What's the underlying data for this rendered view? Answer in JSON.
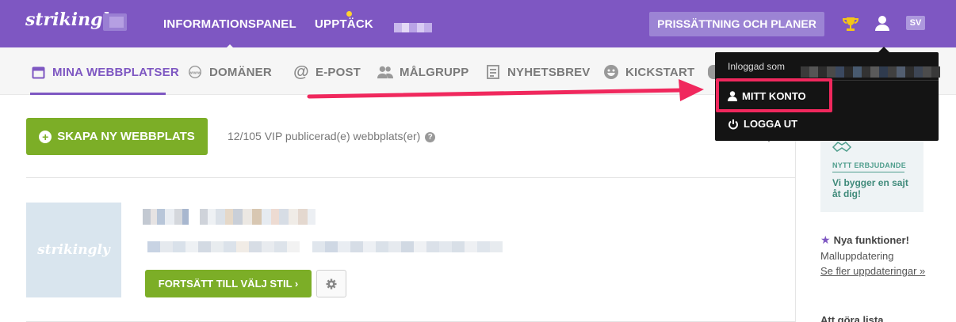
{
  "topbar": {
    "logo": "strikingly",
    "nav": [
      "INFORMATIONSPANEL",
      "UPPTÄCK"
    ],
    "pricing_button": "PRISSÄTTNING OCH PLANER",
    "language": "SV"
  },
  "subnav": {
    "items": [
      "MINA WEBBPLATSER",
      "DOMÄNER",
      "E-POST",
      "MÅLGRUPP",
      "NYHETSBREV",
      "KICKSTART"
    ]
  },
  "main": {
    "create_button": "SKAPA NY WEBBPLATS",
    "vip_status": "12/105 VIP publicerad(e) webbplats(er)",
    "site_thumb_logo": "strikingly",
    "continue_button": "FORTSÄTT TILL VÄLJ STIL ›"
  },
  "dropdown": {
    "logged_in_as": "Inloggad som",
    "my_account": "MITT KONTO",
    "log_out": "LOGGA UT"
  },
  "sidebar": {
    "promo_label": "NYTT ERBJUDANDE",
    "promo_text": "Vi bygger en sajt åt dig!",
    "new_features": "Nya funktioner!",
    "feature_update": "Malluppdatering",
    "feature_link": "Se fler uppdateringar »",
    "todo": "Att göra lista"
  },
  "colors": {
    "brand_purple": "#7e57c2",
    "green": "#7cae27",
    "highlight_pink": "#f0285d"
  }
}
